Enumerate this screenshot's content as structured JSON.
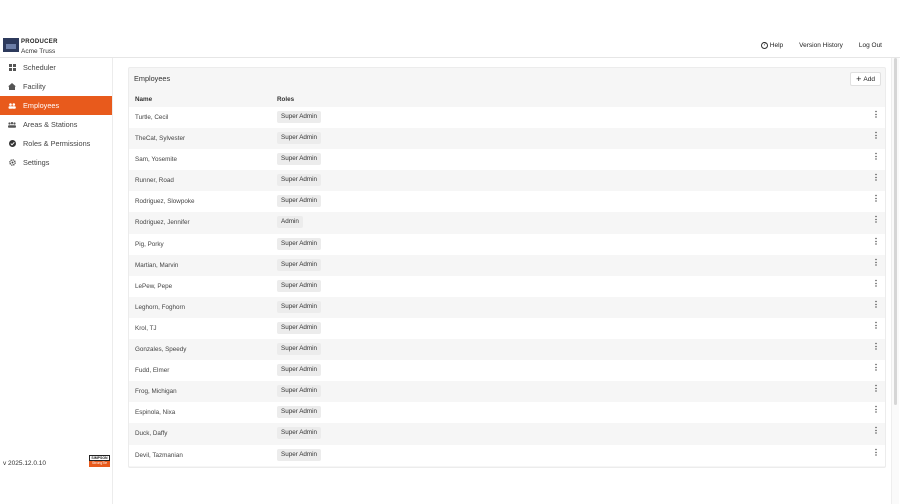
{
  "app": {
    "product": "PRODUCER",
    "facility": "Acme Truss"
  },
  "topnav": {
    "help": "Help",
    "version_history": "Version History",
    "logout": "Log Out"
  },
  "sidebar": {
    "items": [
      {
        "label": "Scheduler",
        "icon": "grid-icon"
      },
      {
        "label": "Facility",
        "icon": "home-icon"
      },
      {
        "label": "Employees",
        "icon": "people-icon",
        "active": true
      },
      {
        "label": "Areas & Stations",
        "icon": "group-icon"
      },
      {
        "label": "Roles & Permissions",
        "icon": "check-circle-icon"
      },
      {
        "label": "Settings",
        "icon": "gear-icon"
      }
    ],
    "version": "v 2025.12.0.10",
    "brand_top": "SIMPSON",
    "brand_bottom": "StrongTie"
  },
  "colors": {
    "accent": "#e85a1c",
    "panel_bg": "#f6f6f6",
    "badge_bg": "#ececec"
  },
  "employees": {
    "title": "Employees",
    "add_label": "Add",
    "columns": {
      "name": "Name",
      "roles": "Roles"
    },
    "rows": [
      {
        "name": "Turtle, Cecil",
        "role": "Super Admin"
      },
      {
        "name": "TheCat, Sylvester",
        "role": "Super Admin"
      },
      {
        "name": "Sam, Yosemite",
        "role": "Super Admin"
      },
      {
        "name": "Runner, Road",
        "role": "Super Admin"
      },
      {
        "name": "Rodriguez, Slowpoke",
        "role": "Super Admin"
      },
      {
        "name": "Rodriguez, Jennifer",
        "role": "Admin"
      },
      {
        "name": "Pig, Porky",
        "role": "Super Admin"
      },
      {
        "name": "Martian, Marvin",
        "role": "Super Admin"
      },
      {
        "name": "LePew, Pepe",
        "role": "Super Admin"
      },
      {
        "name": "Leghorn, Foghorn",
        "role": "Super Admin"
      },
      {
        "name": "Krol, TJ",
        "role": "Super Admin"
      },
      {
        "name": "Gonzales, Speedy",
        "role": "Super Admin"
      },
      {
        "name": "Fudd, Elmer",
        "role": "Super Admin"
      },
      {
        "name": "Frog, Michigan",
        "role": "Super Admin"
      },
      {
        "name": "Espinola, Nixa",
        "role": "Super Admin"
      },
      {
        "name": "Duck, Daffy",
        "role": "Super Admin"
      },
      {
        "name": "Devil, Tazmanian",
        "role": "Super Admin"
      }
    ]
  }
}
